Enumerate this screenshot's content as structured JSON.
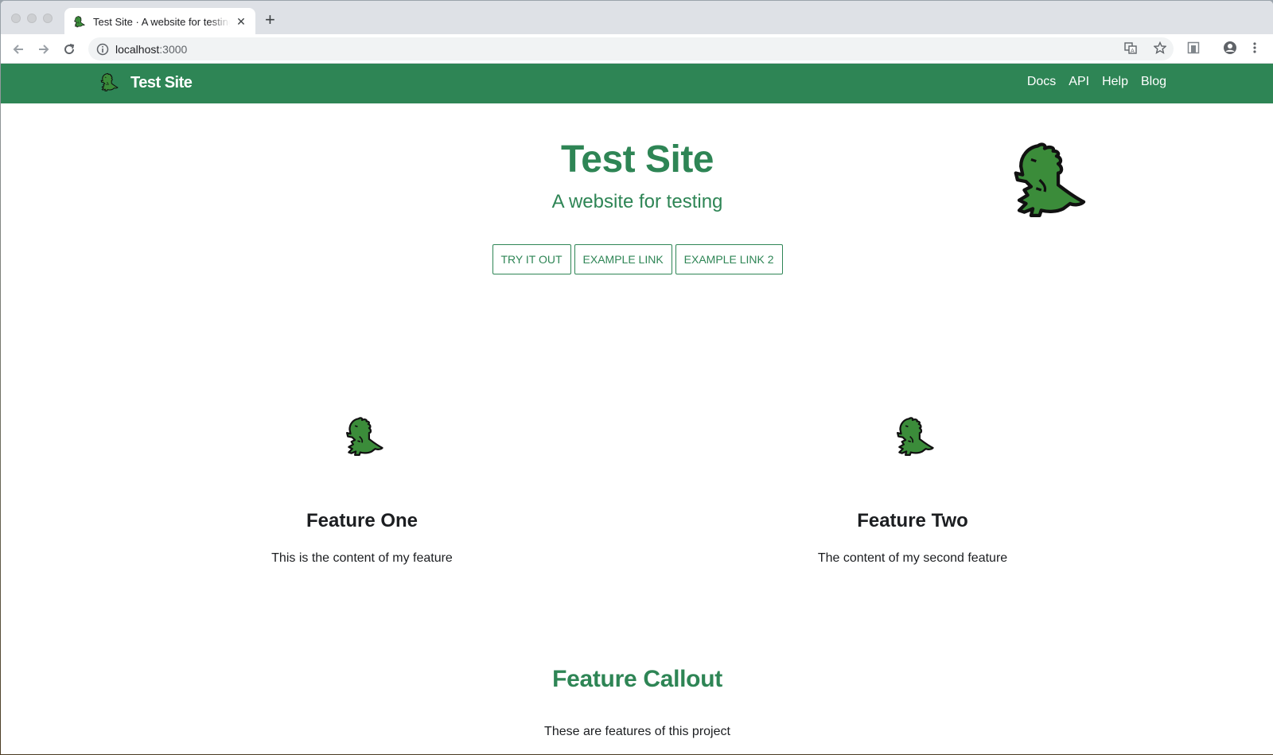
{
  "browser": {
    "tab": {
      "title": "Test Site · A website for testing"
    },
    "url": {
      "host": "localhost",
      "port": ":3000"
    }
  },
  "site": {
    "brand": "Test Site",
    "nav": [
      "Docs",
      "API",
      "Help",
      "Blog"
    ],
    "accent_color": "#2e8555"
  },
  "hero": {
    "title": "Test Site",
    "subtitle": "A website for testing",
    "buttons": [
      "TRY IT OUT",
      "EXAMPLE LINK",
      "EXAMPLE LINK 2"
    ]
  },
  "features": [
    {
      "title": "Feature One",
      "text": "This is the content of my feature",
      "icon": "dinosaur-icon"
    },
    {
      "title": "Feature Two",
      "text": "The content of my second feature",
      "icon": "dinosaur-icon"
    }
  ],
  "callout": {
    "title": "Feature Callout",
    "text": "These are features of this project"
  }
}
